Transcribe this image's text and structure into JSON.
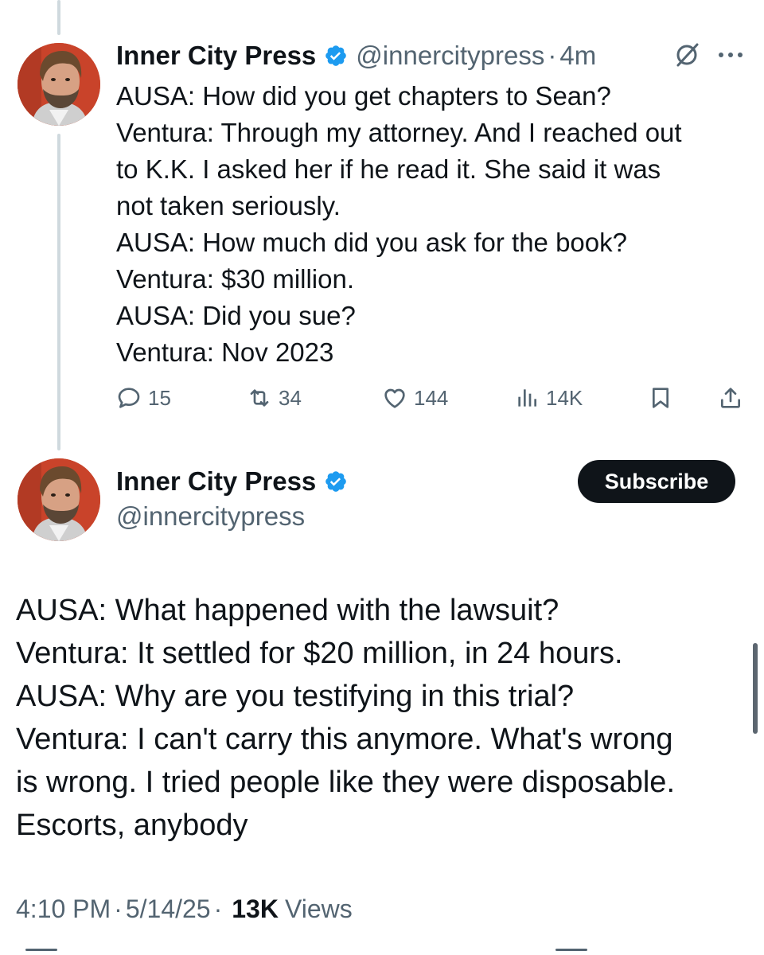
{
  "tweet1": {
    "display_name": "Inner City Press",
    "handle": "@innercitypress",
    "separator": "·",
    "time": "4m",
    "lines": [
      "AUSA: How did you get chapters to Sean?",
      "Ventura: Through my attorney. And I reached out",
      "to K.K. I asked her if he read it. She said it was",
      "not taken seriously.",
      "AUSA: How much did you ask for the book?",
      "Ventura: $30 million.",
      "AUSA: Did you sue?",
      "Ventura: Nov 2023"
    ],
    "actions": {
      "replies": "15",
      "reposts": "34",
      "likes": "144",
      "views": "14K"
    }
  },
  "tweet2": {
    "display_name": "Inner City Press",
    "handle": "@innercitypress",
    "subscribe_label": "Subscribe",
    "lines": [
      "AUSA: What happened with the lawsuit?",
      "Ventura: It settled for $20 million, in 24 hours.",
      "AUSA: Why are you testifying in this trial?",
      "Ventura: I can't carry this anymore. What's wrong",
      "is wrong. I tried people like they were disposable.",
      "Escorts, anybody"
    ],
    "meta": {
      "time": "4:10 PM",
      "separator": "·",
      "date": "5/14/25",
      "views_count": "13K",
      "views_label": "Views"
    }
  },
  "colors": {
    "verified": "#1d9bf0",
    "secondary_text": "#536471",
    "primary_text": "#0f1419",
    "thread_line": "#cfd9de",
    "subscribe_bg": "#0f1419"
  },
  "icons": {
    "verified": "verified-badge-icon",
    "grok": "grok-icon",
    "more": "more-dots-icon",
    "reply": "reply-icon",
    "repost": "repost-icon",
    "like": "heart-icon",
    "views": "views-bar-icon",
    "bookmark": "bookmark-icon",
    "share": "share-icon"
  }
}
